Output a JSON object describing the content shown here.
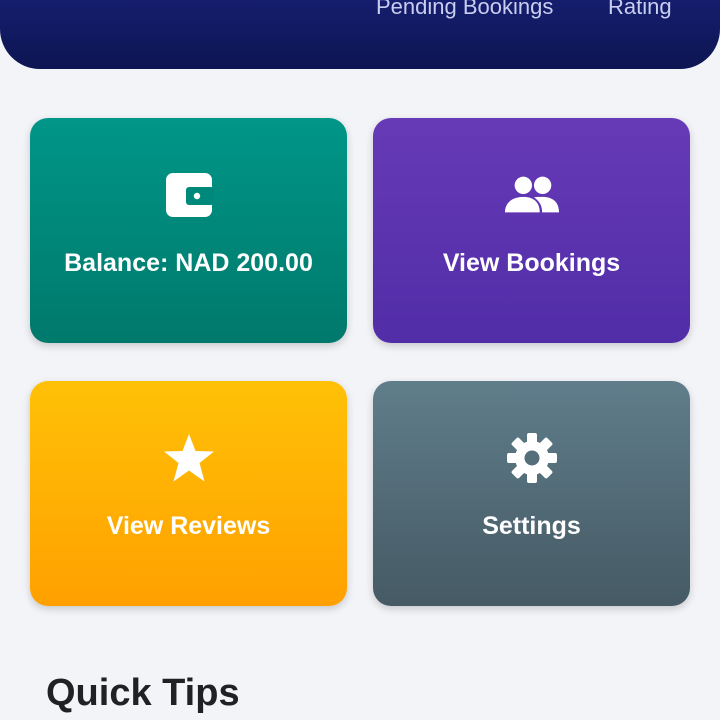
{
  "header": {
    "stats": [
      {
        "label": "Pending Bookings"
      },
      {
        "label": "Rating"
      }
    ],
    "background_color": "#1a237e"
  },
  "tiles": [
    {
      "label": "Balance: NAD 200.00",
      "icon": "wallet-icon",
      "color": "#009688"
    },
    {
      "label": "View Bookings",
      "icon": "people-icon",
      "color": "#673ab7"
    },
    {
      "label": "View Reviews",
      "icon": "star-icon",
      "color": "#ffc107"
    },
    {
      "label": "Settings",
      "icon": "gear-icon",
      "color": "#607d8b"
    }
  ],
  "quick_tips": {
    "title": "Quick Tips"
  }
}
